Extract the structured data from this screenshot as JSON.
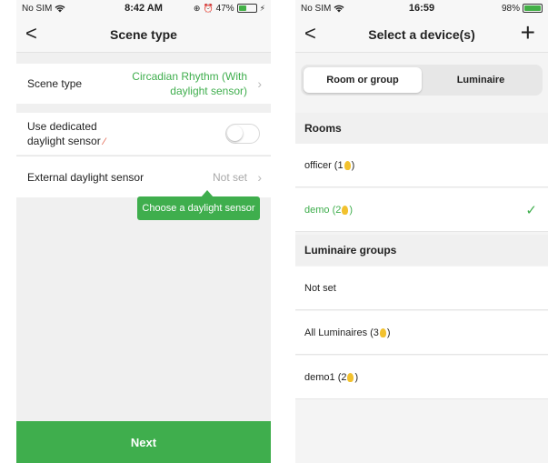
{
  "left": {
    "status": {
      "carrier": "No SIM",
      "time": "8:42 AM",
      "battery": "47%",
      "battery_level": 0.47
    },
    "nav": {
      "title": "Scene type",
      "back": "<"
    },
    "scene_type_row": {
      "label": "Scene type",
      "value_line1": "Circadian Rhythm (With",
      "value_line2": "daylight sensor)"
    },
    "dedicated_row": {
      "label_line1": "Use dedicated",
      "label_line2": "daylight sensor",
      "toggle_on": false
    },
    "external_row": {
      "label": "External daylight sensor",
      "value": "Not set"
    },
    "tooltip": "Choose a daylight sensor",
    "next_button": "Next"
  },
  "right": {
    "status": {
      "carrier": "No SIM",
      "time": "16:59",
      "battery": "98%",
      "battery_level": 0.98
    },
    "nav": {
      "title": "Select a device(s)",
      "back": "<",
      "add": "+"
    },
    "segments": [
      "Room or group",
      "Luminaire"
    ],
    "active_segment": 0,
    "rooms_header": "Rooms",
    "rooms": [
      {
        "name": "officer (1",
        "suffix": ")",
        "selected": false
      },
      {
        "name": "demo (2",
        "suffix": ")",
        "selected": true
      }
    ],
    "groups_header": "Luminaire groups",
    "groups": [
      {
        "name": "Not set",
        "suffix": "",
        "bulb": false
      },
      {
        "name": "All Luminaires (3",
        "suffix": ")",
        "bulb": true
      },
      {
        "name": "demo1 (2",
        "suffix": ")",
        "bulb": true
      }
    ],
    "check_mark": "✓"
  },
  "colors": {
    "accent_green": "#3fae4d",
    "bulb_yellow": "#f2c12e",
    "warning_red": "#e0533b"
  }
}
